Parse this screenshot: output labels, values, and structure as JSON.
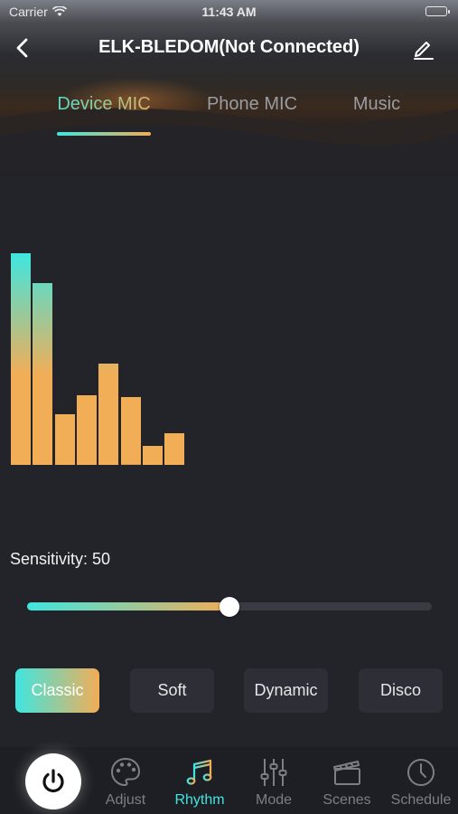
{
  "status_bar": {
    "carrier": "Carrier",
    "time": "11:43 AM"
  },
  "header": {
    "title": "ELK-BLEDOM(Not Connected)"
  },
  "tabs": [
    {
      "label": "Device MIC",
      "active": true
    },
    {
      "label": "Phone MIC",
      "active": false
    },
    {
      "label": "Music",
      "active": false
    }
  ],
  "visualizer": {
    "levels": [
      1.0,
      0.86,
      0.24,
      0.33,
      0.48,
      0.32,
      0.09,
      0.15
    ],
    "colors": {
      "top": "#3fe6e0",
      "bottom": "#f2ad57"
    }
  },
  "sensitivity": {
    "label": "Sensitivity: 50",
    "value": 50,
    "max": 100
  },
  "modes": [
    {
      "label": "Classic",
      "active": true
    },
    {
      "label": "Soft",
      "active": false
    },
    {
      "label": "Dynamic",
      "active": false
    },
    {
      "label": "Disco",
      "active": false
    }
  ],
  "tabbar": {
    "power_icon": "power-icon",
    "items": [
      {
        "label": "Adjust",
        "icon": "palette-icon",
        "active": false
      },
      {
        "label": "Rhythm",
        "icon": "music-note-icon",
        "active": true
      },
      {
        "label": "Mode",
        "icon": "sliders-icon",
        "active": false
      },
      {
        "label": "Scenes",
        "icon": "clapperboard-icon",
        "active": false
      },
      {
        "label": "Schedule",
        "icon": "clock-icon",
        "active": false
      }
    ]
  },
  "colors": {
    "accent_cyan": "#3fe6e0",
    "accent_orange": "#f2ad57",
    "background": "#23242a"
  }
}
